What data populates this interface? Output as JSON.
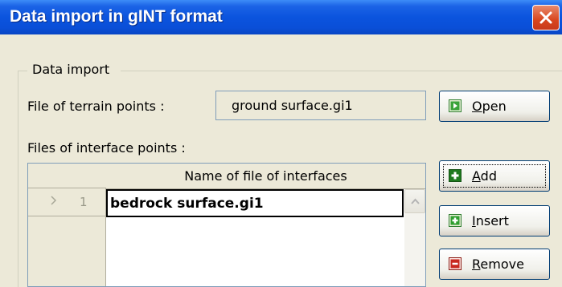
{
  "window": {
    "title": "Data import in gINT format"
  },
  "group": {
    "label": "Data import"
  },
  "terrain": {
    "label": "File of terrain points :",
    "value": "ground surface.gi1",
    "open_button": "Open"
  },
  "interfaces": {
    "label": "Files of interface points :",
    "column_header": "Name of file of interfaces",
    "rows": [
      {
        "index": "1",
        "name": "bedrock surface.gi1"
      }
    ],
    "add_button": "Add",
    "insert_button": "Insert",
    "remove_button": "Remove"
  },
  "colors": {
    "titlebar": "#0a4fd8",
    "close": "#d9461e",
    "dialog": "#ece9d8",
    "icon_green": "#2e9e2e",
    "icon_red": "#c8281e"
  },
  "icons": [
    "close-icon",
    "open-icon",
    "add-icon",
    "insert-icon",
    "remove-icon",
    "row-arrow-icon",
    "scroll-up-icon"
  ]
}
